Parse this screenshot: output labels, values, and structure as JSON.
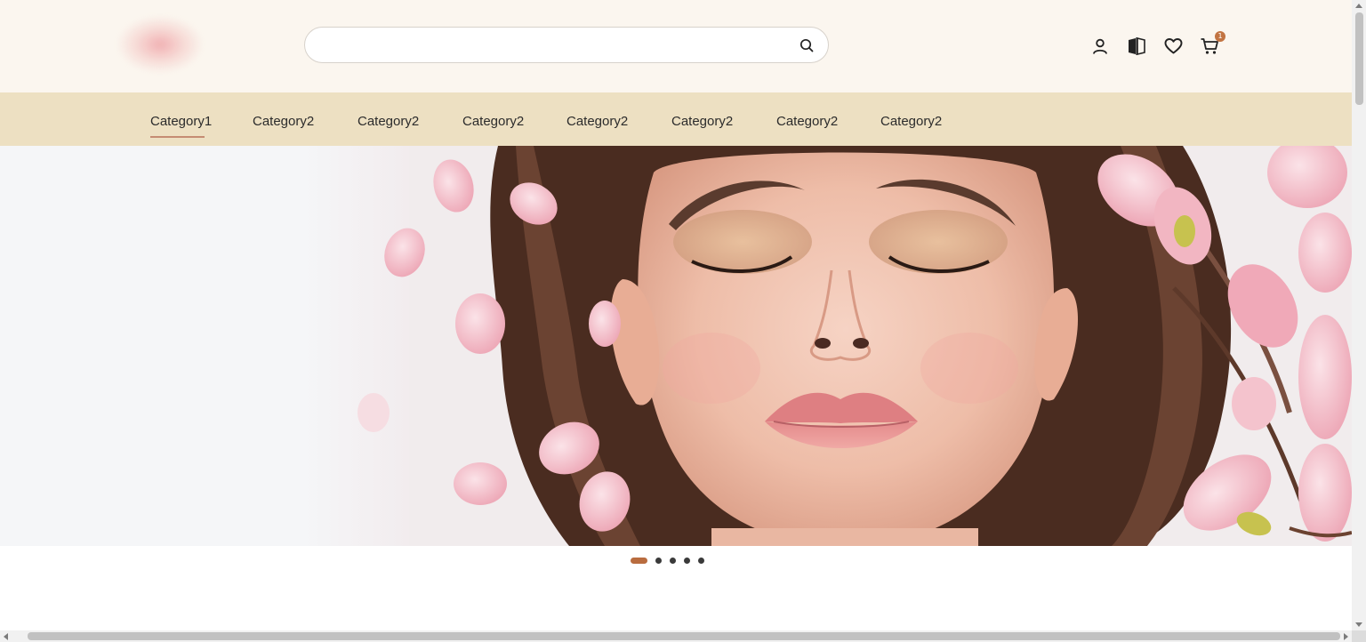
{
  "header": {
    "logo_alt": "",
    "search": {
      "value": "",
      "placeholder": ""
    },
    "icons": [
      "account-icon",
      "compare-icon",
      "wishlist-icon",
      "cart-icon"
    ],
    "cart_count": "1"
  },
  "nav": {
    "items": [
      {
        "label": "Category1",
        "active": true
      },
      {
        "label": "Category2"
      },
      {
        "label": "Category2"
      },
      {
        "label": "Category2"
      },
      {
        "label": "Category2"
      },
      {
        "label": "Category2"
      },
      {
        "label": "Category2"
      },
      {
        "label": "Category2"
      }
    ]
  },
  "hero": {
    "slide_count": 5,
    "active_slide": 1
  },
  "colors": {
    "header_bg": "#fbf6ef",
    "nav_bg": "#ede0c2",
    "accent": "#b96c3f",
    "active_underline": "#c58c73"
  }
}
